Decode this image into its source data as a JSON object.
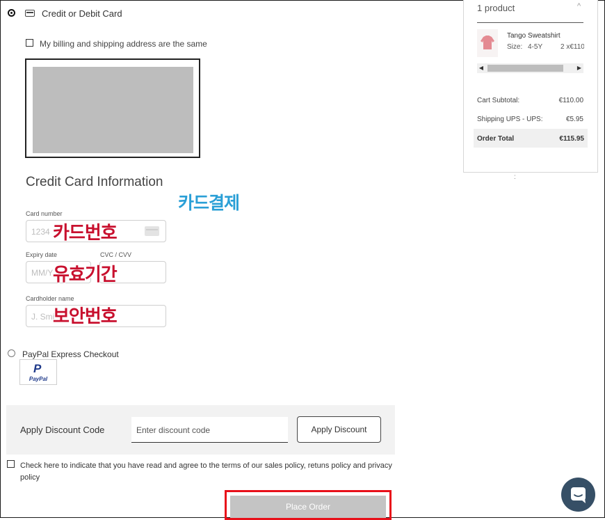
{
  "payment": {
    "card_option_label": "Credit or Debit Card",
    "billing_same_label": "My billing and shipping address are the same",
    "section_title": "Credit Card Information",
    "card_number_label": "Card number",
    "card_number_placeholder": "1234",
    "expiry_label": "Expiry date",
    "expiry_placeholder": "MM/Y",
    "cvc_label": "CVC / CVV",
    "cardholder_label": "Cardholder name",
    "cardholder_placeholder": "J. Smi",
    "paypal_option_label": "PayPal Express Checkout",
    "paypal_logo_text": "PayPal"
  },
  "annotations": {
    "card_payment": "카드결제",
    "card_number": "카드번호",
    "expiry": "유효기간",
    "security_code": "보안번호"
  },
  "discount": {
    "label": "Apply Discount Code",
    "placeholder": "Enter discount code",
    "button": "Apply Discount"
  },
  "terms": {
    "label": "Check here to indicate that you have read and agree to the terms of our sales policy, retuns policy and privacy policy"
  },
  "place_order": {
    "label": "Place Order"
  },
  "summary": {
    "product_count": "1 product",
    "item": {
      "name": "Tango Sweatshirt",
      "size_label": "Size:",
      "size_value": "4-5Y",
      "qty_price": "2 x€110"
    },
    "rows": [
      {
        "label": "Cart Subtotal:",
        "value": "€110.00"
      },
      {
        "label": "Shipping UPS - UPS:",
        "value": "€5.95"
      },
      {
        "label": "Order Total",
        "value": "€115.95"
      }
    ],
    "scroll_left": "◀",
    "scroll_right": "▶",
    "chevron": "^",
    "handle": ":"
  },
  "colors": {
    "highlight_red": "#e8101a",
    "discount_bg": "#f2f2f2",
    "order_button_bg": "#c4c4c4",
    "chat_bubble": "#364f66",
    "product_pink": "#e48a92"
  }
}
